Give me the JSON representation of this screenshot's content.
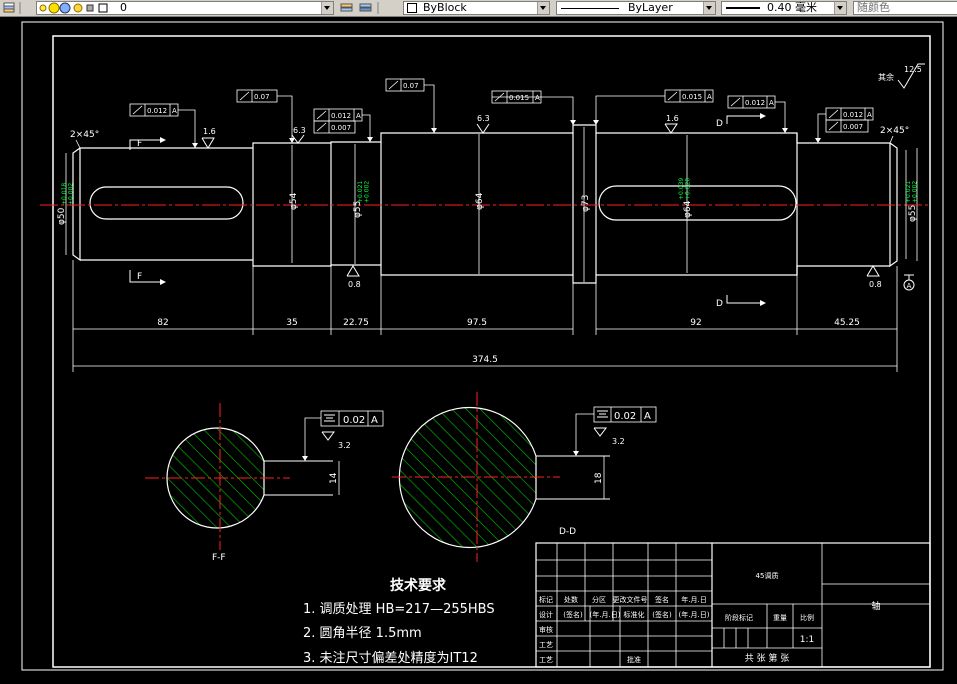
{
  "toolbar": {
    "layer_name": "0",
    "color": "ByBlock",
    "linetype": "ByLayer",
    "lineweight": "0.40 毫米",
    "plotstyle": "随颜色"
  },
  "drawing": {
    "chamfer_left": "2×45°",
    "chamfer_right": "2×45°",
    "section_mark_f": "F",
    "section_mark_d": "D",
    "roughness_others": "其余",
    "roughness_others_value": "12.5",
    "roughness": {
      "r1": "1.6",
      "r2": "6.3",
      "r3": "6.3",
      "r4": "1.6",
      "r5": "0.8",
      "r6": "0.8"
    },
    "tolerances": {
      "t1": "0.012",
      "t2": "0.07",
      "t3a": "0.012",
      "t3b": "0.007",
      "t4": "0.07",
      "t5": "0.015",
      "t6": "0.015",
      "t7": "0.012",
      "t8a": "0.012",
      "t8b": "0.007",
      "datum": "A",
      "t9": "0.02",
      "t10": "0.02",
      "t9_roughness": "3.2",
      "t10_roughness": "3.2"
    },
    "diameters": {
      "d1": "φ50",
      "d2": "φ54",
      "d3": "φ55",
      "d4": "φ64",
      "d5": "φ73",
      "d6": "φ64",
      "d7": "φ55",
      "fit_lr": "+0.018\n+0.002",
      "fit_l2": "+0.021\n+0.002",
      "fit_r1": "+0.039\n+0.020",
      "fit_r2": "+0.021\n+0.002"
    },
    "lengths": {
      "l1": "82",
      "l2": "35",
      "l3": "22.75",
      "l4": "97.5",
      "l5": "92",
      "l6": "45.25",
      "total": "374.5"
    },
    "datum_mark": "A",
    "section_ff": {
      "label": "F-F",
      "key_width": "14"
    },
    "section_dd": {
      "label": "D-D",
      "key_width": "18"
    },
    "notes": {
      "title": "技术要求",
      "n1": "1. 调质处理 HB=217—255HBS",
      "n2": "2. 圆角半径  1.5mm",
      "n3": "3. 未注尺寸偏差处精度为IT12"
    },
    "title_block": {
      "material": "45调质",
      "part_name": "轴",
      "scale": "1:1",
      "sheets": "共 张 第 张",
      "h_mark": "标记",
      "h_count": "处数",
      "h_zone": "分区",
      "h_docno": "更改文件号",
      "h_sign": "签名",
      "h_date": "年.月.日",
      "r_design": "设计",
      "r_std": "标准化",
      "r_stage": "阶段标记",
      "r_weight": "重量",
      "r_scale": "比例",
      "r_check": "审核",
      "r_process": "工艺",
      "r_approve": "批准",
      "sign_ph": "(签名)",
      "date_ph": "(年.月.日)"
    }
  }
}
